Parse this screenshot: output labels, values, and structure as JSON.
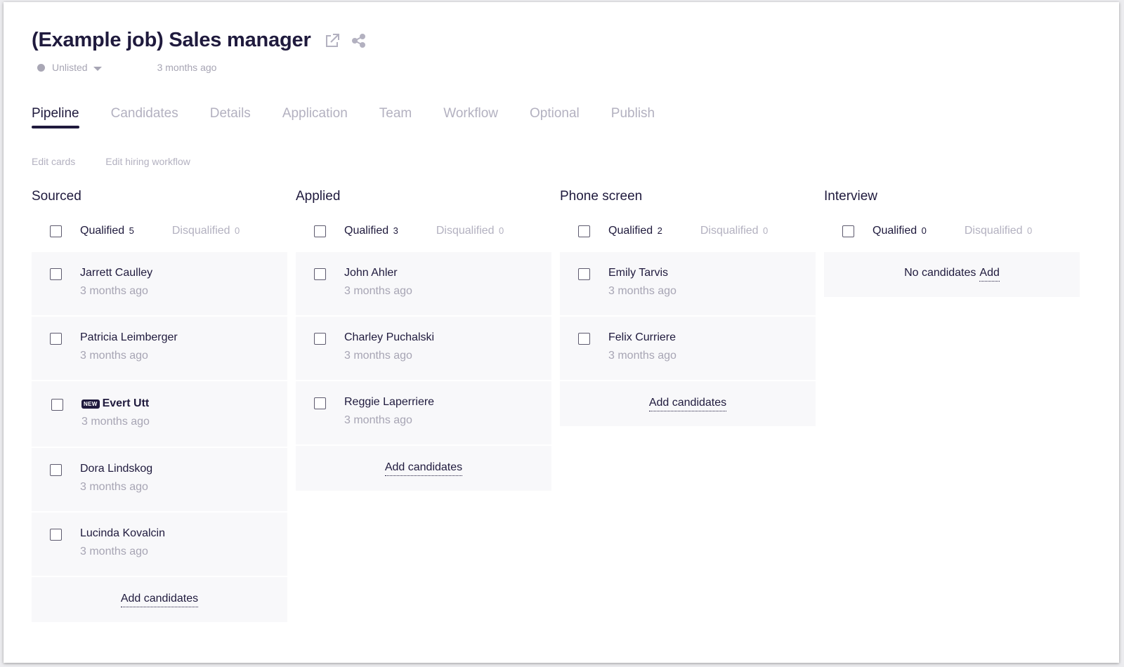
{
  "job": {
    "title": "(Example job) Sales manager",
    "status": "Unlisted",
    "created": "3 months ago"
  },
  "tabs": [
    "Pipeline",
    "Candidates",
    "Details",
    "Application",
    "Team",
    "Workflow",
    "Optional",
    "Publish"
  ],
  "subnav": {
    "edit_cards": "Edit cards",
    "edit_workflow": "Edit hiring workflow"
  },
  "labels": {
    "qualified": "Qualified",
    "disqualified": "Disqualified",
    "add_candidates": "Add candidates",
    "no_candidates": "No candidates",
    "add": "Add",
    "new_badge": "NEW"
  },
  "columns": [
    {
      "title": "Sourced",
      "qualified": "5",
      "disqualified": "0",
      "candidates": [
        {
          "name": "Jarrett Caulley",
          "date": "3 months ago"
        },
        {
          "name": "Patricia Leimberger",
          "date": "3 months ago"
        },
        {
          "name": "Evert Utt",
          "date": "3 months ago",
          "is_new": true
        },
        {
          "name": "Dora Lindskog",
          "date": "3 months ago"
        },
        {
          "name": "Lucinda Kovalcin",
          "date": "3 months ago"
        }
      ]
    },
    {
      "title": "Applied",
      "qualified": "3",
      "disqualified": "0",
      "candidates": [
        {
          "name": "John Ahler",
          "date": "3 months ago"
        },
        {
          "name": "Charley Puchalski",
          "date": "3 months ago"
        },
        {
          "name": "Reggie Laperriere",
          "date": "3 months ago"
        }
      ]
    },
    {
      "title": "Phone screen",
      "qualified": "2",
      "disqualified": "0",
      "candidates": [
        {
          "name": "Emily Tarvis",
          "date": "3 months ago"
        },
        {
          "name": "Felix Curriere",
          "date": "3 months ago"
        }
      ]
    },
    {
      "title": "Interview",
      "qualified": "0",
      "disqualified": "0",
      "candidates": []
    }
  ]
}
